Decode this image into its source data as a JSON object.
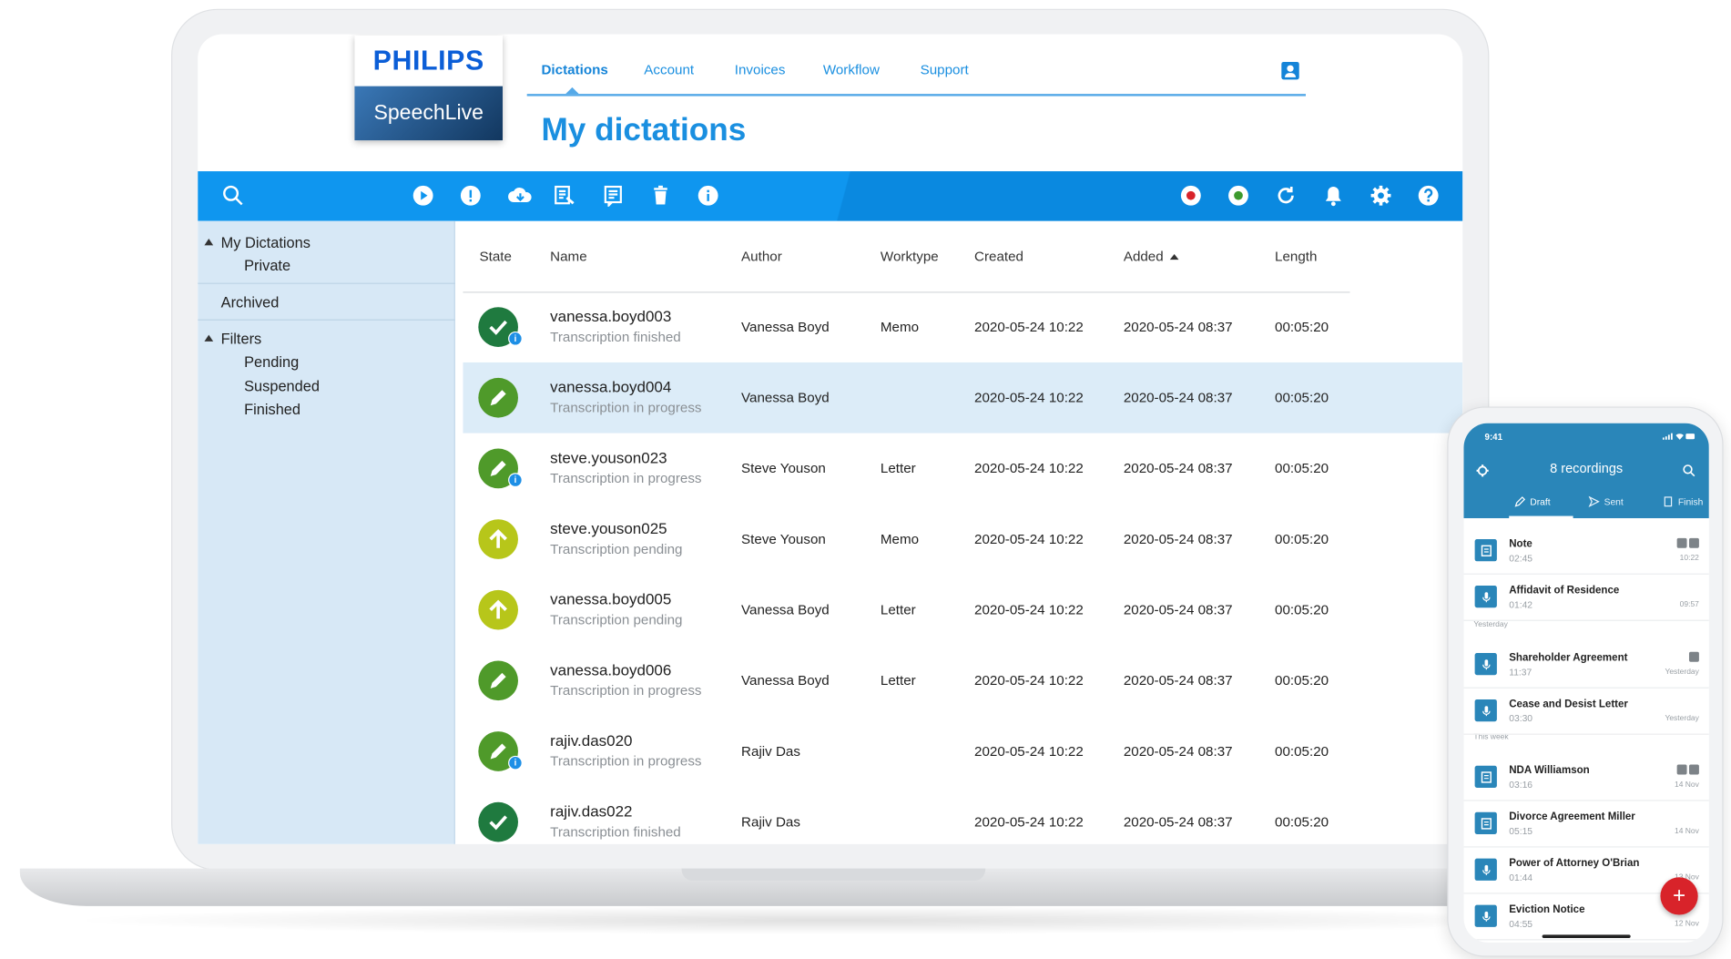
{
  "brand": {
    "name": "PHILIPS",
    "product": "SpeechLive"
  },
  "nav": {
    "tabs": [
      "Dictations",
      "Account",
      "Invoices",
      "Workflow",
      "Support"
    ],
    "active": "Dictations"
  },
  "page": {
    "title": "My dictations"
  },
  "toolbar": {
    "left_icons": [
      "search-icon"
    ],
    "actions": [
      "play-icon",
      "priority-icon",
      "download-cloud-icon",
      "transcription-doc-icon",
      "comment-icon",
      "trash-icon",
      "info-icon"
    ],
    "right_icons": [
      "record-red-icon",
      "record-green-icon",
      "refresh-icon",
      "bell-icon",
      "gear-icon",
      "help-icon"
    ]
  },
  "sidebar": {
    "my_dictations": "My Dictations",
    "private": "Private",
    "archived": "Archived",
    "filters": "Filters",
    "filter_items": [
      "Pending",
      "Suspended",
      "Finished"
    ]
  },
  "table": {
    "columns": [
      "State",
      "Name",
      "Author",
      "Worktype",
      "Created",
      "Added",
      "Length"
    ],
    "sorted_column": "Added",
    "rows": [
      {
        "state": "finished",
        "name": "vanessa.boyd003",
        "status": "Transcription finished",
        "author": "Vanessa Boyd",
        "worktype": "Memo",
        "created": "2020-05-24  10:22",
        "added": "2020-05-24  08:37",
        "length": "00:05:20",
        "info": true
      },
      {
        "state": "in-progress",
        "name": "vanessa.boyd004",
        "status": "Transcription in progress",
        "author": "Vanessa Boyd",
        "worktype": "",
        "created": "2020-05-24  10:22",
        "added": "2020-05-24  08:37",
        "length": "00:05:20",
        "info": false
      },
      {
        "state": "in-progress",
        "name": "steve.youson023",
        "status": "Transcription in progress",
        "author": "Steve Youson",
        "worktype": "Letter",
        "created": "2020-05-24  10:22",
        "added": "2020-05-24  08:37",
        "length": "00:05:20",
        "info": true
      },
      {
        "state": "pending",
        "name": "steve.youson025",
        "status": "Transcription pending",
        "author": "Steve Youson",
        "worktype": "Memo",
        "created": "2020-05-24  10:22",
        "added": "2020-05-24  08:37",
        "length": "00:05:20",
        "info": false
      },
      {
        "state": "pending",
        "name": "vanessa.boyd005",
        "status": "Transcription pending",
        "author": "Vanessa Boyd",
        "worktype": "Letter",
        "created": "2020-05-24  10:22",
        "added": "2020-05-24  08:37",
        "length": "00:05:20",
        "info": false
      },
      {
        "state": "in-progress",
        "name": "vanessa.boyd006",
        "status": "Transcription in progress",
        "author": "Vanessa Boyd",
        "worktype": "Letter",
        "created": "2020-05-24  10:22",
        "added": "2020-05-24  08:37",
        "length": "00:05:20",
        "info": false
      },
      {
        "state": "in-progress",
        "name": "rajiv.das020",
        "status": "Transcription in progress",
        "author": "Rajiv Das",
        "worktype": "",
        "created": "2020-05-24  10:22",
        "added": "2020-05-24  08:37",
        "length": "00:05:20",
        "info": true
      },
      {
        "state": "finished",
        "name": "rajiv.das022",
        "status": "Transcription finished",
        "author": "Rajiv Das",
        "worktype": "",
        "created": "2020-05-24  10:22",
        "added": "2020-05-24  08:37",
        "length": "00:05:20",
        "info": false
      }
    ],
    "selected_row": 1
  },
  "phone": {
    "time": "9:41",
    "title": "8 recordings",
    "tabs": [
      "Draft",
      "Sent",
      "Finish"
    ],
    "sections": {
      "yesterday": "Yesterday",
      "this_week": "This week"
    },
    "recordings": [
      {
        "name": "Note",
        "duration": "02:45",
        "when": "10:22",
        "badges": 2,
        "icon": "note-icon"
      },
      {
        "name": "Affidavit of Residence",
        "duration": "01:42",
        "when": "09:57",
        "badges": 0,
        "icon": "mic-icon"
      },
      {
        "name": "Shareholder Agreement",
        "duration": "11:37",
        "when": "Yesterday",
        "badges": 1,
        "icon": "mic-icon"
      },
      {
        "name": "Cease and Desist Letter",
        "duration": "03:30",
        "when": "Yesterday",
        "badges": 0,
        "icon": "mic-icon"
      },
      {
        "name": "NDA Williamson",
        "duration": "03:16",
        "when": "14 Nov",
        "badges": 2,
        "icon": "note-icon"
      },
      {
        "name": "Divorce Agreement Miller",
        "duration": "05:15",
        "when": "14 Nov",
        "badges": 0,
        "icon": "note-icon"
      },
      {
        "name": "Power of Attorney O'Brian",
        "duration": "01:44",
        "when": "13 Nov",
        "badges": 0,
        "icon": "mic-icon"
      },
      {
        "name": "Eviction Notice",
        "duration": "04:55",
        "when": "12 Nov",
        "badges": 0,
        "icon": "mic-icon"
      }
    ],
    "fab": "+"
  },
  "colors": {
    "accent": "#0f96ef",
    "title": "#1a8fe0",
    "sidebar": "#d7e8f6",
    "finished": "#1f7a3f",
    "in_progress": "#4f9a2a",
    "pending": "#b7c61a",
    "record": "#d8232a"
  }
}
